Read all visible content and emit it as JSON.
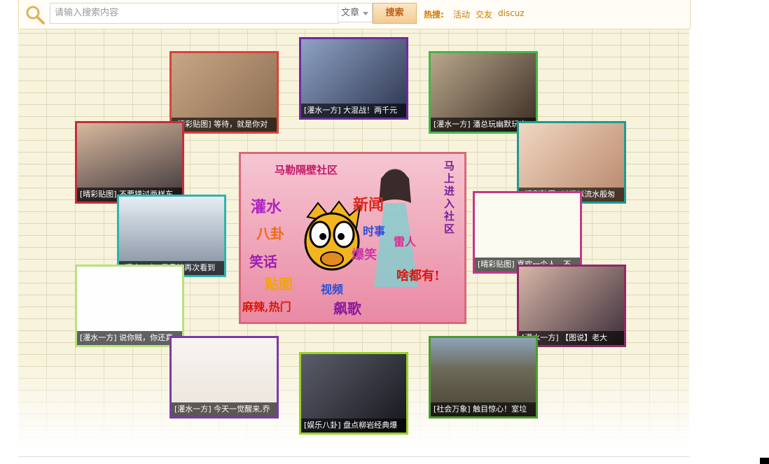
{
  "search": {
    "placeholder": "请输入搜索内容",
    "type_selected": "文章",
    "button_label": "搜索"
  },
  "hot": {
    "label": "热搜:",
    "links": [
      "活动",
      "交友",
      "discuz"
    ]
  },
  "center_banner": {
    "title": "马勒隔壁社区",
    "words": [
      "灌水",
      "新闻",
      "八卦",
      "时事",
      "笑话",
      "爆笑",
      "雷人",
      "贴图",
      "视频",
      "麻辣,热门",
      "飙歌",
      "马上进入社区",
      "啥都有!"
    ]
  },
  "tiles": [
    {
      "caption": "[晴彩贴图] 等待，就是你对",
      "border": "#d9423b",
      "bg": "#b7936f"
    },
    {
      "caption": "[灌水一方] 大混战！两千元",
      "border": "#6d2c9c",
      "bg": "#5a6c8a"
    },
    {
      "caption": "[灌水一方] 潘总玩幽默玩出",
      "border": "#48b24a",
      "bg": "#5b4a3a"
    },
    {
      "caption": "[晴彩贴图] 不要错过两样东",
      "border": "#c52e3a",
      "bg": "#3b3438"
    },
    {
      "caption": "[晴彩贴图] 时间似流水般匆",
      "border": "#1f9a92",
      "bg": "#d9b79a"
    },
    {
      "caption": "[灌水一方] 我承认再次看到",
      "border": "#2fb3b2",
      "bg": "#b9c7d6"
    },
    {
      "caption": "[晴彩贴图] 喜欢一个人，不",
      "border": "#c7368b",
      "bg": "#fbfaf0"
    },
    {
      "caption": "[灌水一方] 说你贼，你还真",
      "border": "#b7e27a",
      "bg": "#fefefe"
    },
    {
      "caption": "[灌水一方] 【图说】老大",
      "border": "#8c2a66",
      "bg": "#6b4e56"
    },
    {
      "caption": "[灌水一方] 今天一觉醒来,乔",
      "border": "#7c3aa5",
      "bg": "#f4f1ee"
    },
    {
      "caption": "[娱乐八卦] 盘点柳岩经典爆",
      "border": "#9ad128",
      "bg": "#2b2c33"
    },
    {
      "caption": "[社会万象] 触目惊心！室垃",
      "border": "#4e9a32",
      "bg": "#6b6a59"
    }
  ]
}
